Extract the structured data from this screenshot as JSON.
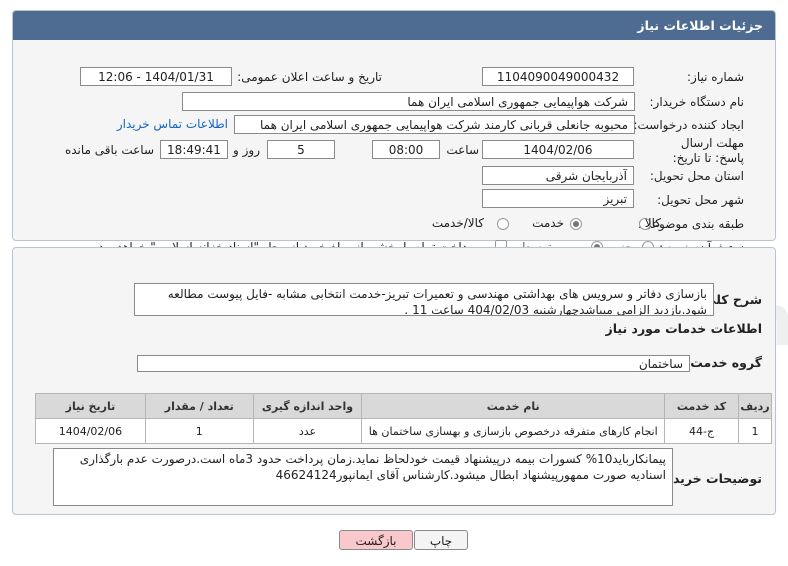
{
  "header": {
    "title": "جزئیات اطلاعات نیاز"
  },
  "fields": {
    "need_number_label": "شماره نیاز:",
    "need_number": "1104090049000432",
    "announce_label": "تاریخ و ساعت اعلان عمومی:",
    "announce_value": "1404/01/31 - 12:06",
    "buyer_label": "نام دستگاه خریدار:",
    "buyer_value": "شرکت هواپیمایی جمهوری اسلامی ایران هما",
    "creator_label": "ایجاد کننده درخواست:",
    "creator_value": "محبوبه جانعلی قربانی کارمند شرکت هواپیمایی جمهوری اسلامی ایران هما",
    "contact_link": "اطلاعات تماس خریدار",
    "deadline_label": "مهلت ارسال پاسخ: تا تاریخ:",
    "deadline_date": "1404/02/06",
    "time_label": "ساعت",
    "deadline_time": "08:00",
    "days_value": "5",
    "days_label": "روز و",
    "remaining_time": "18:49:41",
    "remaining_label": "ساعت باقی مانده",
    "province_label": "استان محل تحویل:",
    "province_value": "آذربایجان شرقی",
    "city_label": "شهر محل تحویل:",
    "city_value": "تبریز",
    "category_label": "طبقه بندی موضوعی:",
    "category_options": [
      "کالا",
      "خدمت",
      "کالا/خدمت"
    ],
    "category_selected": "خدمت",
    "process_label": "نوع فرآیند خرید :",
    "process_options": [
      "جزیی",
      "متوسط"
    ],
    "process_selected": "متوسط",
    "payment_note": "پرداخت تمام یا بخشی از مبلغ خرید،از محل \"اسناد خزانه اسلامی\" خواهد بود."
  },
  "details": {
    "summary_label": "شرح کلی نیاز:",
    "summary_text": "بازسازی دفاتر و سرویس های بهداشتی مهندسی و تعمیرات تبریز-خدمت انتخابی مشابه -فایل پیوست مطالعه شود.بازدید الزامی میباشدچهارشنبه 404/02/03 ساعت 11 .",
    "services_heading": "اطلاعات خدمات مورد نیاز",
    "service_group_label": "گروه خدمت:",
    "service_group_value": "ساختمان",
    "table": {
      "headers": [
        "ردیف",
        "کد خدمت",
        "نام خدمت",
        "واحد اندازه گیری",
        "تعداد / مقدار",
        "تاریخ نیاز"
      ],
      "rows": [
        [
          "1",
          "ج-44",
          "انجام کارهای متفرقه درخصوص بازسازی و بهسازی ساختمان ها",
          "عدد",
          "1",
          "1404/02/06"
        ]
      ]
    },
    "buyer_notes_label": "توضیحات خریدار:",
    "buyer_notes_text": "پیمانکارباید10% کسورات بیمه درپیشنهاد قیمت خودلحاظ نماید.زمان پرداخت حدود 3ماه است.درصورت عدم بارگذاری اسنادیه صورت ممهورپیشنهاد ابطال میشود.کارشناس آقای ایمانپور46624124"
  },
  "buttons": {
    "print": "چاپ",
    "back": "بازگشت"
  },
  "colors": {
    "titlebar": "#4e6c92",
    "link": "#1565c0",
    "back_button": "#f8c8cc"
  },
  "watermark": "AriaTender.neT"
}
